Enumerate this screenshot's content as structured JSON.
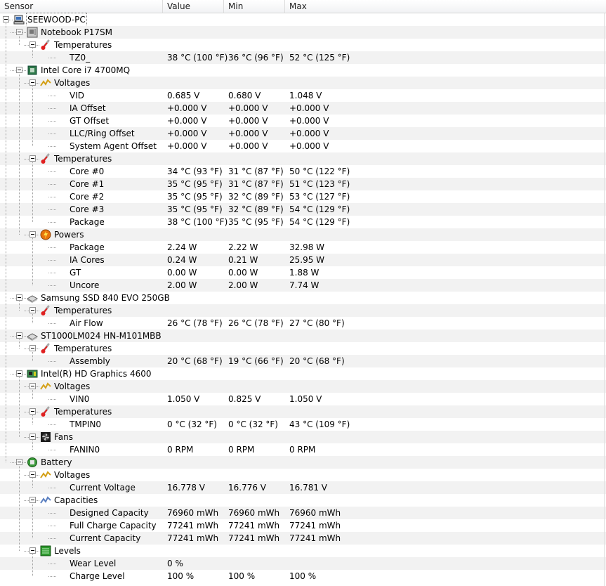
{
  "header": {
    "sensor": "Sensor",
    "value": "Value",
    "min": "Min",
    "max": "Max"
  },
  "rows": [
    {
      "label": "SEEWOOD-PC",
      "level": 0,
      "expand": true,
      "icon": "computer-icon"
    },
    {
      "label": "Notebook P17SM",
      "level": 1,
      "expand": true,
      "icon": "motherboard-icon"
    },
    {
      "label": "Temperatures",
      "level": 2,
      "expand": true,
      "icon": "thermometer-icon"
    },
    {
      "label": "TZ0_",
      "level": 3,
      "value": "38 °C  (100 °F)",
      "min": "36 °C  (96 °F)",
      "max": "52 °C  (125 °F)"
    },
    {
      "label": "Intel Core i7 4700MQ",
      "level": 1,
      "expand": true,
      "icon": "cpu-icon"
    },
    {
      "label": "Voltages",
      "level": 2,
      "expand": true,
      "icon": "voltage-icon"
    },
    {
      "label": "VID",
      "level": 3,
      "value": "0.685 V",
      "min": "0.680 V",
      "max": "1.048 V"
    },
    {
      "label": "IA Offset",
      "level": 3,
      "value": "+0.000 V",
      "min": "+0.000 V",
      "max": "+0.000 V"
    },
    {
      "label": "GT Offset",
      "level": 3,
      "value": "+0.000 V",
      "min": "+0.000 V",
      "max": "+0.000 V"
    },
    {
      "label": "LLC/Ring Offset",
      "level": 3,
      "value": "+0.000 V",
      "min": "+0.000 V",
      "max": "+0.000 V"
    },
    {
      "label": "System Agent Offset",
      "level": 3,
      "value": "+0.000 V",
      "min": "+0.000 V",
      "max": "+0.000 V"
    },
    {
      "label": "Temperatures",
      "level": 2,
      "expand": true,
      "icon": "thermometer-icon"
    },
    {
      "label": "Core #0",
      "level": 3,
      "value": "34 °C  (93 °F)",
      "min": "31 °C  (87 °F)",
      "max": "50 °C  (122 °F)"
    },
    {
      "label": "Core #1",
      "level": 3,
      "value": "35 °C  (95 °F)",
      "min": "31 °C  (87 °F)",
      "max": "51 °C  (123 °F)"
    },
    {
      "label": "Core #2",
      "level": 3,
      "value": "35 °C  (95 °F)",
      "min": "32 °C  (89 °F)",
      "max": "53 °C  (127 °F)"
    },
    {
      "label": "Core #3",
      "level": 3,
      "value": "35 °C  (95 °F)",
      "min": "32 °C  (89 °F)",
      "max": "54 °C  (129 °F)"
    },
    {
      "label": "Package",
      "level": 3,
      "value": "38 °C  (100 °F)",
      "min": "35 °C  (95 °F)",
      "max": "54 °C  (129 °F)"
    },
    {
      "label": "Powers",
      "level": 2,
      "expand": true,
      "icon": "power-icon"
    },
    {
      "label": "Package",
      "level": 3,
      "value": "2.24 W",
      "min": "2.22 W",
      "max": "32.98 W"
    },
    {
      "label": "IA Cores",
      "level": 3,
      "value": "0.24 W",
      "min": "0.21 W",
      "max": "25.95 W"
    },
    {
      "label": "GT",
      "level": 3,
      "value": "0.00 W",
      "min": "0.00 W",
      "max": "1.88 W"
    },
    {
      "label": "Uncore",
      "level": 3,
      "value": "2.00 W",
      "min": "2.00 W",
      "max": "7.74 W"
    },
    {
      "label": "Samsung SSD 840 EVO 250GB",
      "level": 1,
      "expand": true,
      "icon": "disk-icon"
    },
    {
      "label": "Temperatures",
      "level": 2,
      "expand": true,
      "icon": "thermometer-icon"
    },
    {
      "label": "Air Flow",
      "level": 3,
      "value": "26 °C  (78 °F)",
      "min": "26 °C  (78 °F)",
      "max": "27 °C  (80 °F)"
    },
    {
      "label": "ST1000LM024 HN-M101MBB",
      "level": 1,
      "expand": true,
      "icon": "disk-icon"
    },
    {
      "label": "Temperatures",
      "level": 2,
      "expand": true,
      "icon": "thermometer-icon"
    },
    {
      "label": "Assembly",
      "level": 3,
      "value": "20 °C  (68 °F)",
      "min": "19 °C  (66 °F)",
      "max": "20 °C  (68 °F)"
    },
    {
      "label": "Intel(R) HD Graphics 4600",
      "level": 1,
      "expand": true,
      "icon": "gpu-icon"
    },
    {
      "label": "Voltages",
      "level": 2,
      "expand": true,
      "icon": "voltage-icon"
    },
    {
      "label": "VIN0",
      "level": 3,
      "value": "1.050 V",
      "min": "0.825 V",
      "max": "1.050 V"
    },
    {
      "label": "Temperatures",
      "level": 2,
      "expand": true,
      "icon": "thermometer-icon"
    },
    {
      "label": "TMPIN0",
      "level": 3,
      "value": "0 °C  (32 °F)",
      "min": "0 °C  (32 °F)",
      "max": "43 °C  (109 °F)"
    },
    {
      "label": "Fans",
      "level": 2,
      "expand": true,
      "icon": "fan-icon"
    },
    {
      "label": "FANIN0",
      "level": 3,
      "value": "0 RPM",
      "min": "0 RPM",
      "max": "0 RPM"
    },
    {
      "label": "Battery",
      "level": 1,
      "expand": true,
      "icon": "battery-icon"
    },
    {
      "label": "Voltages",
      "level": 2,
      "expand": true,
      "icon": "voltage-icon"
    },
    {
      "label": "Current Voltage",
      "level": 3,
      "value": "16.778 V",
      "min": "16.776 V",
      "max": "16.781 V"
    },
    {
      "label": "Capacities",
      "level": 2,
      "expand": true,
      "icon": "capacity-icon"
    },
    {
      "label": "Designed Capacity",
      "level": 3,
      "value": "76960 mWh",
      "min": "76960 mWh",
      "max": "76960 mWh"
    },
    {
      "label": "Full Charge Capacity",
      "level": 3,
      "value": "77241 mWh",
      "min": "77241 mWh",
      "max": "77241 mWh"
    },
    {
      "label": "Current Capacity",
      "level": 3,
      "value": "77241 mWh",
      "min": "77241 mWh",
      "max": "77241 mWh"
    },
    {
      "label": "Levels",
      "level": 2,
      "expand": true,
      "icon": "level-icon"
    },
    {
      "label": "Wear Level",
      "level": 3,
      "value": "0 %",
      "min": "",
      "max": ""
    },
    {
      "label": "Charge Level",
      "level": 3,
      "value": "100 %",
      "min": "100 %",
      "max": "100 %"
    }
  ]
}
